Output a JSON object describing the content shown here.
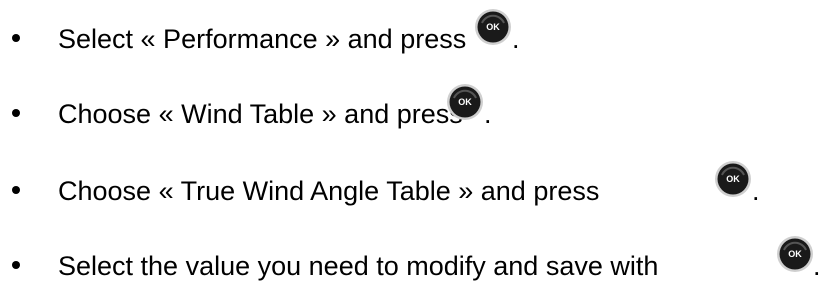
{
  "items": [
    {
      "before": "Select « Performance » and press",
      "button": "OK",
      "after": "."
    },
    {
      "before": "Choose « Wind Table » and press",
      "button": "OK",
      "after": "."
    },
    {
      "before": "Choose « True Wind Angle Table » and press",
      "button": "OK",
      "after": "."
    },
    {
      "before": "Select the value you need to modify and save with",
      "button": "OK",
      "after": "."
    }
  ],
  "colors": {
    "text": "#000000",
    "ok_button_fill": "#1a1a1a",
    "ok_button_rim": "#cfcfcf"
  },
  "icon": "ok-button-icon"
}
